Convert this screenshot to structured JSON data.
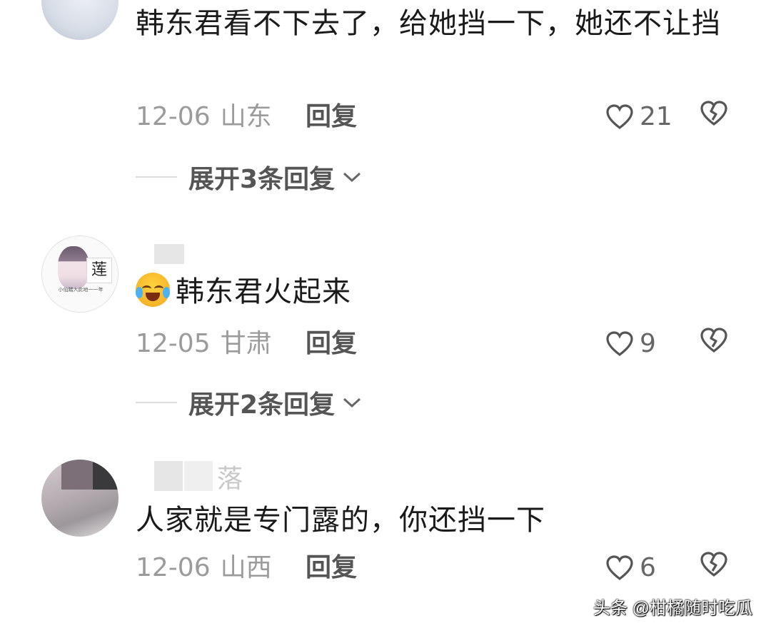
{
  "comments": [
    {
      "text": "韩东君看不下去了，给她挡一下，她还不让挡",
      "date": "12-06",
      "region": "山东",
      "reply_label": "回复",
      "likes": "21",
      "expand_label": "展开3条回复"
    },
    {
      "avatar_text": "莲",
      "avatar_tiny": "小仙踏入此地一一年",
      "text": "韩东君火起来",
      "date": "12-05",
      "region": "甘肃",
      "reply_label": "回复",
      "likes": "9",
      "expand_label": "展开2条回复"
    },
    {
      "username_suffix": "落",
      "text": "人家就是专门露的，你还挡一下",
      "date": "12-06",
      "region": "山西",
      "reply_label": "回复",
      "likes": "6"
    }
  ],
  "watermark": "头条 @柑橘随时吃瓜",
  "colors": {
    "text": "#1a1a1a",
    "meta": "#9b9b9b",
    "reply": "#555555",
    "background": "#ffffff"
  }
}
